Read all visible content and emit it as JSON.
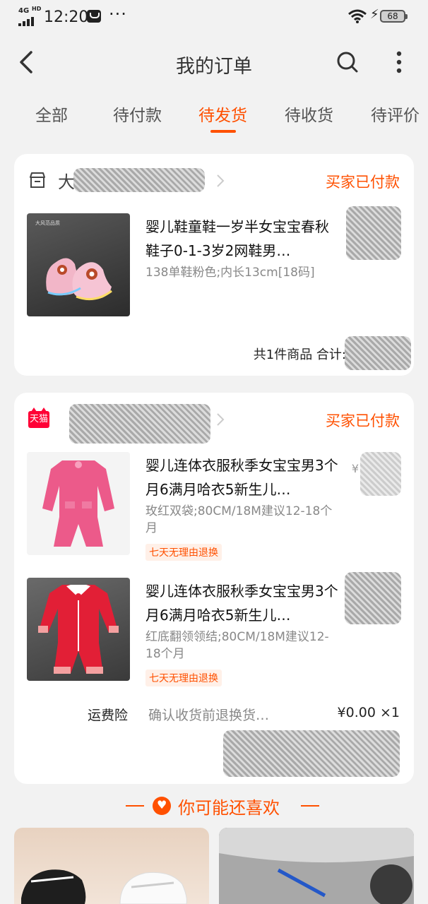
{
  "status_bar": {
    "network": "4G",
    "network_sup": "HD",
    "time": "12:20",
    "more": "···",
    "battery": "68"
  },
  "header": {
    "title": "我的订单",
    "icons": [
      "back-icon",
      "search-icon",
      "more-vertical-icon"
    ]
  },
  "tabs": [
    {
      "label": "全部",
      "active": false
    },
    {
      "label": "待付款",
      "active": false
    },
    {
      "label": "待发货",
      "active": true
    },
    {
      "label": "待收货",
      "active": false
    },
    {
      "label": "待评价",
      "active": false
    }
  ],
  "orders": [
    {
      "shop_icon": "store-icon",
      "shop_name_visible": "大",
      "status": "买家已付款",
      "items": [
        {
          "title": "婴儿鞋童鞋一岁半女宝宝春秋鞋子0-1-3岁2网鞋男…",
          "spec": "138单鞋粉色;内长13cm[18码]"
        }
      ],
      "summary": "共1件商品 合计:"
    },
    {
      "shop_icon": "tmall-icon",
      "shop_badge": "天猫",
      "status": "买家已付款",
      "items": [
        {
          "title": "婴儿连体衣服秋季女宝宝男3个月6满月哈衣5新生儿…",
          "spec": "玫红双袋;80CM/18M建议12-18个月",
          "badge": "七天无理由退换",
          "price_prefix": "¥"
        },
        {
          "title": "婴儿连体衣服秋季女宝宝男3个月6满月哈衣5新生儿…",
          "spec": "红底翻领领结;80CM/18M建议12-18个月",
          "badge": "七天无理由退换"
        }
      ],
      "insurance": {
        "label": "运费险",
        "desc": "确认收货前退换货…",
        "price": "¥0.00 ×1"
      }
    }
  ],
  "recommend": {
    "title": "你可能还喜欢"
  },
  "colors": {
    "accent": "#ff5000",
    "tmall_red": "#ff0036",
    "background": "#f2f2f2"
  }
}
